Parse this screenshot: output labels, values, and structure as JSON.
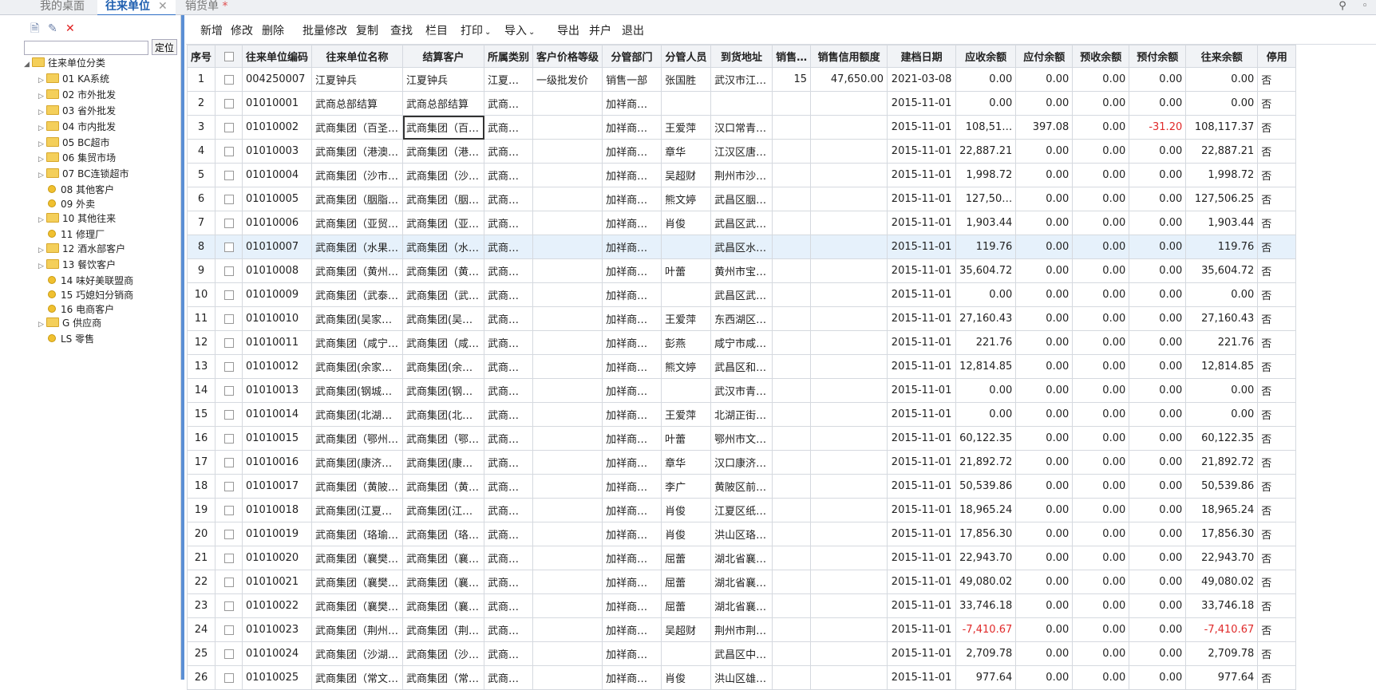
{
  "tabs": [
    {
      "label": "我的桌面",
      "active": false,
      "closable": false,
      "dirty": false
    },
    {
      "label": "往来单位",
      "active": true,
      "closable": true,
      "dirty": false
    },
    {
      "label": "销货单",
      "active": false,
      "closable": false,
      "dirty": true
    }
  ],
  "tab_close_glyph": "✕",
  "tab_dirty_glyph": "*",
  "left": {
    "icons": [
      "new-file-icon",
      "edit-icon",
      "delete-icon"
    ],
    "search_value": "",
    "locate_label": "定位",
    "tree_root": "往来单位分类",
    "tree": [
      {
        "label": "01 KA系统",
        "folder": true
      },
      {
        "label": "02 市外批发",
        "folder": true
      },
      {
        "label": "03 省外批发",
        "folder": true
      },
      {
        "label": "04 市内批发",
        "folder": true
      },
      {
        "label": "05 BC超市",
        "folder": true
      },
      {
        "label": "06 集贸市场",
        "folder": true
      },
      {
        "label": "07 BC连锁超市",
        "folder": true
      },
      {
        "label": "08 其他客户",
        "folder": false
      },
      {
        "label": "09 外卖",
        "folder": false
      },
      {
        "label": "10 其他往来",
        "folder": true
      },
      {
        "label": "11 修理厂",
        "folder": false
      },
      {
        "label": "12 酒水部客户",
        "folder": true
      },
      {
        "label": "13 餐饮客户",
        "folder": true
      },
      {
        "label": "14 味好美联盟商",
        "folder": false
      },
      {
        "label": "15 巧媳妇分销商",
        "folder": false
      },
      {
        "label": "16 电商客户",
        "folder": false
      },
      {
        "label": "G 供应商",
        "folder": true
      },
      {
        "label": "LS 零售",
        "folder": false
      }
    ]
  },
  "toolbar": [
    {
      "label": "新增",
      "menu": false
    },
    {
      "label": "修改",
      "menu": false
    },
    {
      "label": "删除",
      "menu": false
    },
    {
      "label": "批量修改",
      "menu": false
    },
    {
      "label": "复制",
      "menu": false
    },
    {
      "label": "查找",
      "menu": false
    },
    {
      "label": "栏目",
      "menu": false
    },
    {
      "label": "打印",
      "menu": true
    },
    {
      "label": "导入",
      "menu": true
    },
    {
      "label": "导出",
      "menu": false
    },
    {
      "label": "并户",
      "menu": false
    },
    {
      "label": "退出",
      "menu": false
    }
  ],
  "columns": [
    "序号",
    "",
    "往来单位编码",
    "往来单位名称",
    "结算客户",
    "所属类别",
    "客户价格等级",
    "分管部门",
    "分管人员",
    "到货地址",
    "销售…",
    "销售信用额度",
    "建档日期",
    "应收余额",
    "应付余额",
    "预收余额",
    "预付余额",
    "往来余额",
    "停用"
  ],
  "rows": [
    [
      "1",
      "",
      "004250007",
      "江夏钟兵",
      "江夏钟兵",
      "江夏…",
      "一级批发价",
      "销售一部",
      "张国胜",
      "武汉市江…",
      "15",
      "47,650.00",
      "2021-03-08",
      "0.00",
      "0.00",
      "0.00",
      "0.00",
      "0.00",
      "否"
    ],
    [
      "2",
      "",
      "01010001",
      "武商总部结算",
      "武商总部结算",
      "武商…",
      "",
      "加祥商…",
      "",
      "",
      "",
      "",
      "2015-11-01",
      "0.00",
      "0.00",
      "0.00",
      "0.00",
      "0.00",
      "否"
    ],
    [
      "3",
      "",
      "01010002",
      "武商集团（百圣…",
      "武商集团（百…",
      "武商…",
      "",
      "加祥商…",
      "王爱萍",
      "汉口常青…",
      "",
      "",
      "2015-11-01",
      "108,51…",
      "397.08",
      "0.00",
      "-31.20",
      "108,117.37",
      "否"
    ],
    [
      "4",
      "",
      "01010003",
      "武商集团（港澳…",
      "武商集团（港…",
      "武商…",
      "",
      "加祥商…",
      "章华",
      "江汉区唐…",
      "",
      "",
      "2015-11-01",
      "22,887.21",
      "0.00",
      "0.00",
      "0.00",
      "22,887.21",
      "否"
    ],
    [
      "5",
      "",
      "01010004",
      "武商集团（沙市…",
      "武商集团（沙…",
      "武商…",
      "",
      "加祥商…",
      "吴超财",
      "荆州市沙…",
      "",
      "",
      "2015-11-01",
      "1,998.72",
      "0.00",
      "0.00",
      "0.00",
      "1,998.72",
      "否"
    ],
    [
      "6",
      "",
      "01010005",
      "武商集团（胭脂…",
      "武商集团（胭…",
      "武商…",
      "",
      "加祥商…",
      "熊文婷",
      "武昌区胭…",
      "",
      "",
      "2015-11-01",
      "127,50…",
      "0.00",
      "0.00",
      "0.00",
      "127,506.25",
      "否"
    ],
    [
      "7",
      "",
      "01010006",
      "武商集团（亚贸…",
      "武商集团（亚…",
      "武商…",
      "",
      "加祥商…",
      "肖俊",
      "武昌区武…",
      "",
      "",
      "2015-11-01",
      "1,903.44",
      "0.00",
      "0.00",
      "0.00",
      "1,903.44",
      "否"
    ],
    [
      "8",
      "",
      "01010007",
      "武商集团（水果…",
      "武商集团（水…",
      "武商…",
      "",
      "加祥商…",
      "",
      "武昌区水…",
      "",
      "",
      "2015-11-01",
      "119.76",
      "0.00",
      "0.00",
      "0.00",
      "119.76",
      "否"
    ],
    [
      "9",
      "",
      "01010008",
      "武商集团（黄州…",
      "武商集团（黄…",
      "武商…",
      "",
      "加祥商…",
      "叶蕾",
      "黄州市宝…",
      "",
      "",
      "2015-11-01",
      "35,604.72",
      "0.00",
      "0.00",
      "0.00",
      "35,604.72",
      "否"
    ],
    [
      "10",
      "",
      "01010009",
      "武商集团（武泰…",
      "武商集团（武…",
      "武商…",
      "",
      "加祥商…",
      "",
      "武昌区武…",
      "",
      "",
      "2015-11-01",
      "0.00",
      "0.00",
      "0.00",
      "0.00",
      "0.00",
      "否"
    ],
    [
      "11",
      "",
      "01010010",
      "武商集团(吴家…",
      "武商集团(吴…",
      "武商…",
      "",
      "加祥商…",
      "王爱萍",
      "东西湖区…",
      "",
      "",
      "2015-11-01",
      "27,160.43",
      "0.00",
      "0.00",
      "0.00",
      "27,160.43",
      "否"
    ],
    [
      "12",
      "",
      "01010011",
      "武商集团（咸宁…",
      "武商集团（咸…",
      "武商…",
      "",
      "加祥商…",
      "彭燕",
      "咸宁市咸…",
      "",
      "",
      "2015-11-01",
      "221.76",
      "0.00",
      "0.00",
      "0.00",
      "221.76",
      "否"
    ],
    [
      "13",
      "",
      "01010012",
      "武商集团(余家…",
      "武商集团(余…",
      "武商…",
      "",
      "加祥商…",
      "熊文婷",
      "武昌区和…",
      "",
      "",
      "2015-11-01",
      "12,814.85",
      "0.00",
      "0.00",
      "0.00",
      "12,814.85",
      "否"
    ],
    [
      "14",
      "",
      "01010013",
      "武商集团(钢城…",
      "武商集团(钢…",
      "武商…",
      "",
      "加祥商…",
      "",
      "武汉市青…",
      "",
      "",
      "2015-11-01",
      "0.00",
      "0.00",
      "0.00",
      "0.00",
      "0.00",
      "否"
    ],
    [
      "15",
      "",
      "01010014",
      "武商集团(北湖…",
      "武商集团(北…",
      "武商…",
      "",
      "加祥商…",
      "王爱萍",
      "北湖正街…",
      "",
      "",
      "2015-11-01",
      "0.00",
      "0.00",
      "0.00",
      "0.00",
      "0.00",
      "否"
    ],
    [
      "16",
      "",
      "01010015",
      "武商集团（鄂州…",
      "武商集团（鄂…",
      "武商…",
      "",
      "加祥商…",
      "叶蕾",
      "鄂州市文…",
      "",
      "",
      "2015-11-01",
      "60,122.35",
      "0.00",
      "0.00",
      "0.00",
      "60,122.35",
      "否"
    ],
    [
      "17",
      "",
      "01010016",
      "武商集团(康济…",
      "武商集团(康…",
      "武商…",
      "",
      "加祥商…",
      "章华",
      "汉口康济…",
      "",
      "",
      "2015-11-01",
      "21,892.72",
      "0.00",
      "0.00",
      "0.00",
      "21,892.72",
      "否"
    ],
    [
      "18",
      "",
      "01010017",
      "武商集团（黄陂…",
      "武商集团（黄…",
      "武商…",
      "",
      "加祥商…",
      "李广",
      "黄陂区前…",
      "",
      "",
      "2015-11-01",
      "50,539.86",
      "0.00",
      "0.00",
      "0.00",
      "50,539.86",
      "否"
    ],
    [
      "19",
      "",
      "01010018",
      "武商集团(江夏…",
      "武商集团(江…",
      "武商…",
      "",
      "加祥商…",
      "肖俊",
      "江夏区纸…",
      "",
      "",
      "2015-11-01",
      "18,965.24",
      "0.00",
      "0.00",
      "0.00",
      "18,965.24",
      "否"
    ],
    [
      "20",
      "",
      "01010019",
      "武商集团（珞瑜…",
      "武商集团（珞…",
      "武商…",
      "",
      "加祥商…",
      "肖俊",
      "洪山区珞…",
      "",
      "",
      "2015-11-01",
      "17,856.30",
      "0.00",
      "0.00",
      "0.00",
      "17,856.30",
      "否"
    ],
    [
      "21",
      "",
      "01010020",
      "武商集团（襄樊…",
      "武商集团（襄…",
      "武商…",
      "",
      "加祥商…",
      "屈蕾",
      "湖北省襄…",
      "",
      "",
      "2015-11-01",
      "22,943.70",
      "0.00",
      "0.00",
      "0.00",
      "22,943.70",
      "否"
    ],
    [
      "22",
      "",
      "01010021",
      "武商集团（襄樊…",
      "武商集团（襄…",
      "武商…",
      "",
      "加祥商…",
      "屈蕾",
      "湖北省襄…",
      "",
      "",
      "2015-11-01",
      "49,080.02",
      "0.00",
      "0.00",
      "0.00",
      "49,080.02",
      "否"
    ],
    [
      "23",
      "",
      "01010022",
      "武商集团（襄樊…",
      "武商集团（襄…",
      "武商…",
      "",
      "加祥商…",
      "屈蕾",
      "湖北省襄…",
      "",
      "",
      "2015-11-01",
      "33,746.18",
      "0.00",
      "0.00",
      "0.00",
      "33,746.18",
      "否"
    ],
    [
      "24",
      "",
      "01010023",
      "武商集团（荆州…",
      "武商集团（荆…",
      "武商…",
      "",
      "加祥商…",
      "吴超财",
      "荆州市荆…",
      "",
      "",
      "2015-11-01",
      "-7,410.67",
      "0.00",
      "0.00",
      "0.00",
      "-7,410.67",
      "否"
    ],
    [
      "25",
      "",
      "01010024",
      "武商集团（沙湖…",
      "武商集团（沙…",
      "武商…",
      "",
      "加祥商…",
      "",
      "武昌区中…",
      "",
      "",
      "2015-11-01",
      "2,709.78",
      "0.00",
      "0.00",
      "0.00",
      "2,709.78",
      "否"
    ],
    [
      "26",
      "",
      "01010025",
      "武商集团（常文…",
      "武商集团（常…",
      "武商…",
      "",
      "加祥商…",
      "肖俊",
      "洪山区雄…",
      "",
      "",
      "2015-11-01",
      "977.64",
      "0.00",
      "0.00",
      "0.00",
      "977.64",
      "否"
    ]
  ],
  "selected_row": 8,
  "focused_cell": {
    "row": 3,
    "col": 4
  },
  "negative_color": "#e02a2a"
}
